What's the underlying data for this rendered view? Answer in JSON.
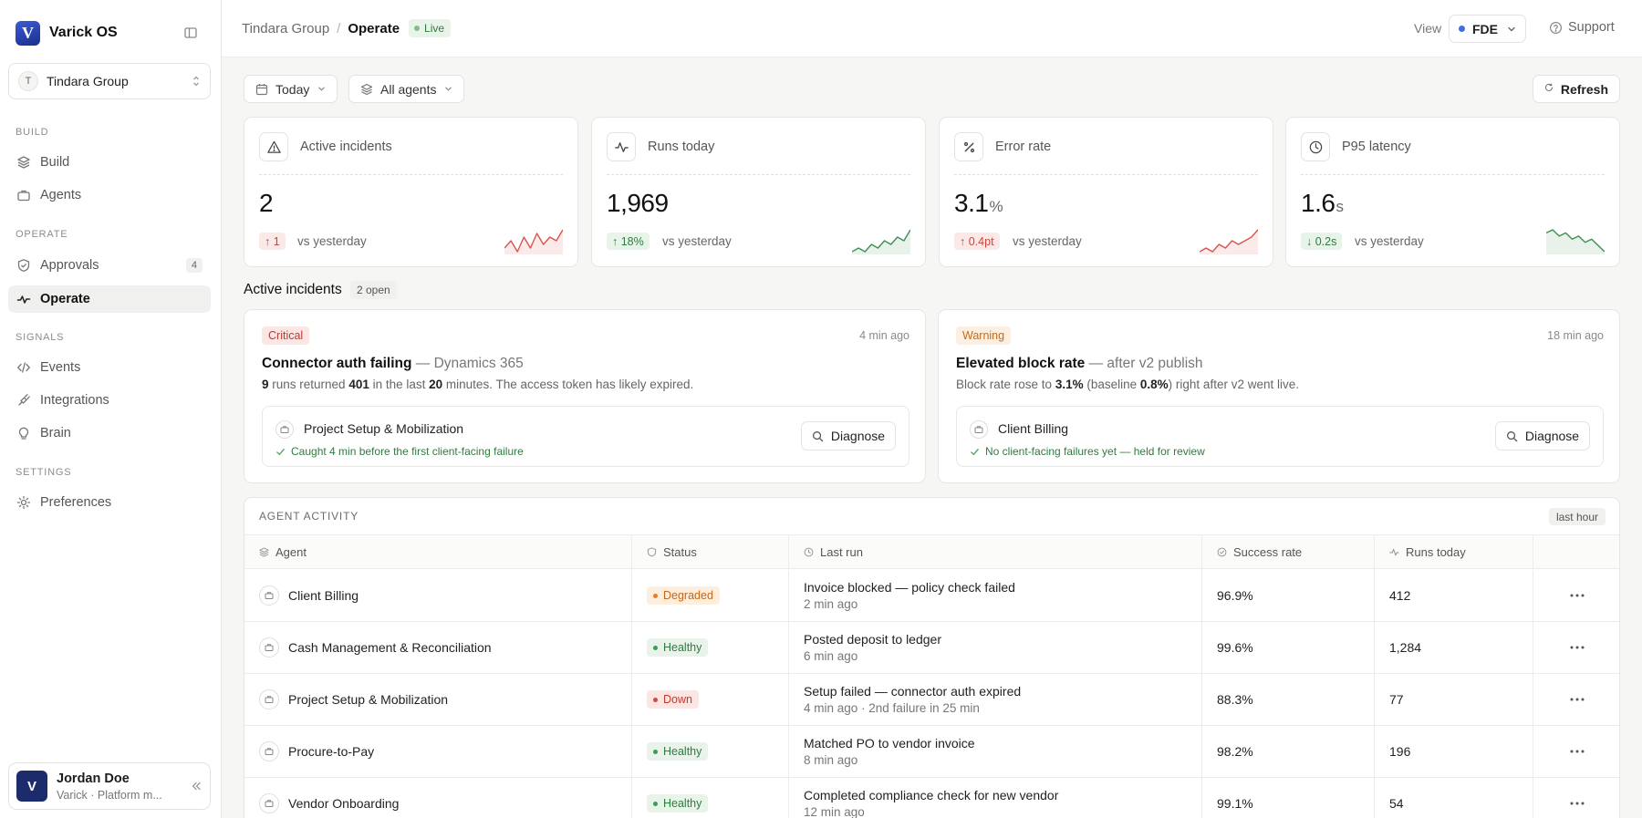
{
  "brand": {
    "name": "Varick OS",
    "logo_letter": "V"
  },
  "org": {
    "initial": "T",
    "name": "Tindara Group"
  },
  "nav": {
    "sections": [
      {
        "label": "BUILD",
        "items": [
          {
            "label": "Build",
            "icon": "layers-icon"
          },
          {
            "label": "Agents",
            "icon": "briefcase-icon"
          }
        ]
      },
      {
        "label": "OPERATE",
        "items": [
          {
            "label": "Approvals",
            "icon": "shield-check-icon",
            "count": "4"
          },
          {
            "label": "Operate",
            "icon": "pulse-icon",
            "active": true
          }
        ]
      },
      {
        "label": "SIGNALS",
        "items": [
          {
            "label": "Events",
            "icon": "code-icon"
          },
          {
            "label": "Integrations",
            "icon": "plug-icon"
          },
          {
            "label": "Brain",
            "icon": "lightbulb-icon"
          }
        ]
      },
      {
        "label": "SETTINGS",
        "items": [
          {
            "label": "Preferences",
            "icon": "gear-icon"
          }
        ]
      }
    ]
  },
  "user": {
    "initial": "V",
    "name": "Jordan Doe",
    "subtitle": "Varick · Platform m..."
  },
  "header": {
    "breadcrumb_parent": "Tindara Group",
    "breadcrumb_sep": "/",
    "breadcrumb_current": "Operate",
    "live_label": "Live",
    "view_label": "View",
    "view_value": "FDE",
    "support_label": "Support"
  },
  "filters": {
    "date": "Today",
    "agents": "All agents",
    "refresh": "Refresh"
  },
  "metrics": [
    {
      "label": "Active incidents",
      "icon": "alert-triangle-icon",
      "value": "2",
      "unit": "",
      "delta": "1",
      "delta_dir": "up",
      "delta_tone": "bad",
      "vs": "vs yesterday",
      "spark": [
        3,
        5,
        2,
        6,
        3,
        7,
        4,
        6,
        5,
        8
      ],
      "spark_color": "#d9534f"
    },
    {
      "label": "Runs today",
      "icon": "activity-icon",
      "value": "1,969",
      "unit": "",
      "delta": "18%",
      "delta_dir": "up",
      "delta_tone": "good",
      "vs": "vs yesterday",
      "spark": [
        2,
        3,
        2,
        4,
        3,
        5,
        4,
        6,
        5,
        8
      ],
      "spark_color": "#3f8f52"
    },
    {
      "label": "Error rate",
      "icon": "percent-icon",
      "value": "3.1",
      "unit": "%",
      "delta": "0.4pt",
      "delta_dir": "up",
      "delta_tone": "bad",
      "vs": "vs yesterday",
      "spark": [
        2,
        3,
        2,
        4,
        3,
        5,
        4,
        5,
        6,
        8
      ],
      "spark_color": "#d9534f"
    },
    {
      "label": "P95 latency",
      "icon": "clock-icon",
      "value": "1.6",
      "unit": "s",
      "delta": "0.2s",
      "delta_dir": "down",
      "delta_tone": "good",
      "vs": "vs yesterday",
      "spark": [
        7,
        8,
        6,
        7,
        5,
        6,
        4,
        5,
        3,
        1
      ],
      "spark_color": "#3f8f52"
    }
  ],
  "incidents_section": {
    "title": "Active incidents",
    "count": "2 open"
  },
  "incidents": [
    {
      "severity": "Critical",
      "severity_tone": "critical",
      "time": "4 min ago",
      "title": "Connector auth failing",
      "subtitle": "— Dynamics 365",
      "desc": [
        {
          "t": "9",
          "b": true
        },
        {
          "t": " runs returned ",
          "b": false
        },
        {
          "t": "401",
          "b": true
        },
        {
          "t": " in the last ",
          "b": false
        },
        {
          "t": "20",
          "b": true
        },
        {
          "t": " minutes. The access token has likely expired.",
          "b": false
        }
      ],
      "agent": "Project Setup & Mobilization",
      "note": "Caught 4 min before the first client-facing failure",
      "action": "Diagnose"
    },
    {
      "severity": "Warning",
      "severity_tone": "warning",
      "time": "18 min ago",
      "title": "Elevated block rate",
      "subtitle": "— after v2 publish",
      "desc": [
        {
          "t": "Block rate rose to ",
          "b": false
        },
        {
          "t": "3.1%",
          "b": true
        },
        {
          "t": " (baseline ",
          "b": false
        },
        {
          "t": "0.8%",
          "b": true
        },
        {
          "t": ") right after v2 went live.",
          "b": false
        }
      ],
      "agent": "Client Billing",
      "note": "No client-facing failures yet — held for review",
      "action": "Diagnose"
    }
  ],
  "activity": {
    "title": "AGENT ACTIVITY",
    "range": "last hour",
    "columns": [
      {
        "label": "Agent",
        "icon": "layers-icon"
      },
      {
        "label": "Status",
        "icon": "shield-icon"
      },
      {
        "label": "Last run",
        "icon": "clock-icon"
      },
      {
        "label": "Success rate",
        "icon": "check-circle-icon"
      },
      {
        "label": "Runs today",
        "icon": "activity-icon"
      },
      {
        "label": "",
        "icon": ""
      }
    ],
    "rows": [
      {
        "agent": "Client Billing",
        "status": "Degraded",
        "status_tone": "degraded",
        "last_run": "Invoice blocked — policy check failed",
        "last_run_time": "2 min ago",
        "success": "96.9%",
        "runs": "412"
      },
      {
        "agent": "Cash Management & Reconciliation",
        "status": "Healthy",
        "status_tone": "healthy",
        "last_run": "Posted deposit to ledger",
        "last_run_time": "6 min ago",
        "success": "99.6%",
        "runs": "1,284"
      },
      {
        "agent": "Project Setup & Mobilization",
        "status": "Down",
        "status_tone": "down",
        "last_run": "Setup failed — connector auth expired",
        "last_run_time": "4 min ago · 2nd failure in 25 min",
        "success": "88.3%",
        "runs": "77"
      },
      {
        "agent": "Procure-to-Pay",
        "status": "Healthy",
        "status_tone": "healthy",
        "last_run": "Matched PO to vendor invoice",
        "last_run_time": "8 min ago",
        "success": "98.2%",
        "runs": "196"
      },
      {
        "agent": "Vendor Onboarding",
        "status": "Healthy",
        "status_tone": "healthy",
        "last_run": "Completed compliance check for new vendor",
        "last_run_time": "12 min ago",
        "success": "99.1%",
        "runs": "54"
      }
    ]
  }
}
